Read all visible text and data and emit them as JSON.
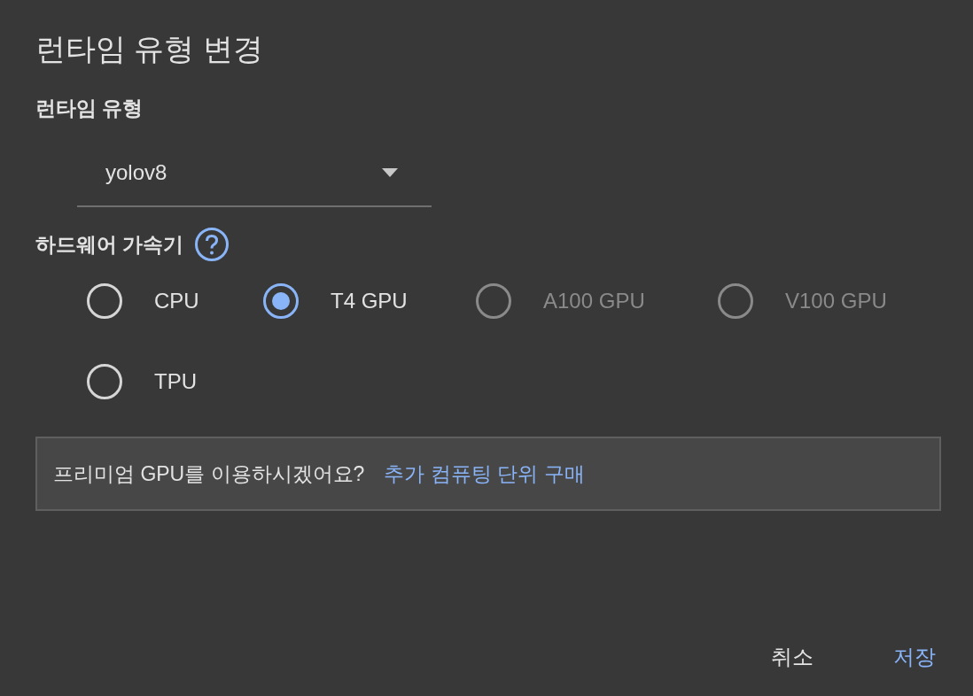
{
  "dialog": {
    "title": "런타임 유형 변경"
  },
  "runtime": {
    "label": "런타임 유형",
    "value": "yolov8"
  },
  "accelerator": {
    "label": "하드웨어 가속기",
    "options": [
      {
        "label": "CPU",
        "selected": false,
        "disabled": false
      },
      {
        "label": "T4 GPU",
        "selected": true,
        "disabled": false
      },
      {
        "label": "A100 GPU",
        "selected": false,
        "disabled": true
      },
      {
        "label": "V100 GPU",
        "selected": false,
        "disabled": true
      },
      {
        "label": "TPU",
        "selected": false,
        "disabled": false
      }
    ]
  },
  "notice": {
    "text": "프리미엄 GPU를 이용하시겠어요?",
    "link": "추가 컴퓨팅 단위 구매"
  },
  "buttons": [
    {
      "label": "취소",
      "kind": "cancel"
    },
    {
      "label": "저장",
      "kind": "save"
    }
  ]
}
